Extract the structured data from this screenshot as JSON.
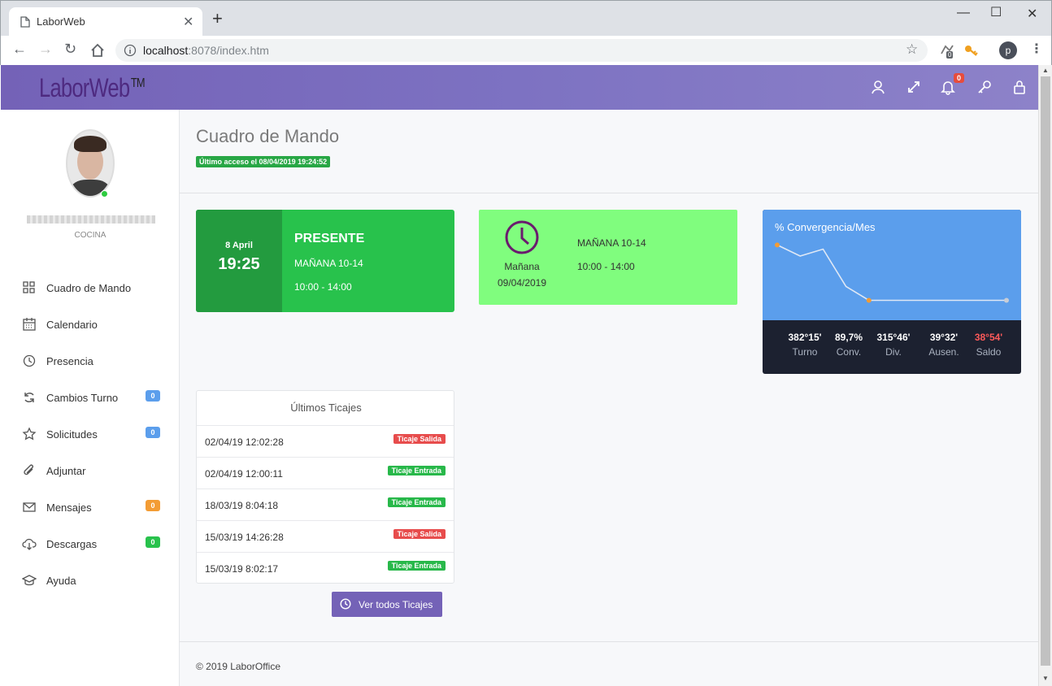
{
  "browser": {
    "tab_title": "LaborWeb",
    "url_host": "localhost",
    "url_rest": ":8078/index.htm",
    "ext_badge": "0",
    "profile_initial": "p"
  },
  "app": {
    "logo": "LaborWeb",
    "logo_tm": "TM",
    "notifications_count": "0",
    "accent": "#7462b7"
  },
  "user": {
    "department": "COCINA"
  },
  "sidebar": {
    "items": [
      {
        "label": "Cuadro de Mando",
        "icon": "grid-icon"
      },
      {
        "label": "Calendario",
        "icon": "calendar-icon"
      },
      {
        "label": "Presencia",
        "icon": "clock-icon"
      },
      {
        "label": "Cambios Turno",
        "icon": "refresh-icon",
        "count": "0",
        "color": "#5b9eec"
      },
      {
        "label": "Solicitudes",
        "icon": "star-icon",
        "count": "0",
        "color": "#5b9eec"
      },
      {
        "label": "Adjuntar",
        "icon": "paperclip-icon"
      },
      {
        "label": "Mensajes",
        "icon": "envelope-icon",
        "count": "0",
        "color": "#f39c34"
      },
      {
        "label": "Descargas",
        "icon": "cloud-download-icon",
        "count": "0",
        "color": "#28c24c"
      },
      {
        "label": "Ayuda",
        "icon": "graduation-cap-icon"
      }
    ]
  },
  "page": {
    "title": "Cuadro de Mando",
    "last_access": "Último acceso el 08/04/2019 19:24:52"
  },
  "status_card": {
    "date": "8 April",
    "time": "19:25",
    "state": "PRESENTE",
    "shift": "MAÑANA 10-14",
    "hours": "10:00 - 14:00"
  },
  "next_card": {
    "day": "Mañana",
    "date": "09/04/2019",
    "shift": "MAÑANA 10-14",
    "hours": "10:00 - 14:00"
  },
  "convergence": {
    "title": "% Convergencia/Mes",
    "stats": [
      {
        "value": "382°15'",
        "label": "Turno"
      },
      {
        "value": "89,7%",
        "label": "Conv."
      },
      {
        "value": "315°46'",
        "label": "Div."
      },
      {
        "value": "39°32'",
        "label": "Ausen."
      },
      {
        "value": "38°54'",
        "label": "Saldo",
        "color": "#ff5a5a"
      }
    ]
  },
  "chart_data": {
    "type": "line",
    "title": "% Convergencia/Mes",
    "series": [
      {
        "values": [
          100,
          92,
          97,
          70,
          60,
          60,
          60,
          60,
          60,
          60,
          60
        ]
      }
    ],
    "ylim": [
      55,
      102
    ],
    "grid": false
  },
  "tickets": {
    "title": "Últimos Ticajes",
    "rows": [
      {
        "date": "02/04/19 12:02:28",
        "badge": "Ticaje Salida",
        "color": "#e74c4c"
      },
      {
        "date": "02/04/19 12:00:11",
        "badge": "Ticaje Entrada",
        "color": "#28b84a"
      },
      {
        "date": "18/03/19 8:04:18",
        "badge": "Ticaje Entrada",
        "color": "#28b84a"
      },
      {
        "date": "15/03/19 14:26:28",
        "badge": "Ticaje Salida",
        "color": "#e74c4c"
      },
      {
        "date": "15/03/19 8:02:17",
        "badge": "Ticaje Entrada",
        "color": "#28b84a"
      }
    ],
    "button": "Ver todos Ticajes"
  },
  "footer": {
    "text": "© 2019 LaborOffice"
  }
}
